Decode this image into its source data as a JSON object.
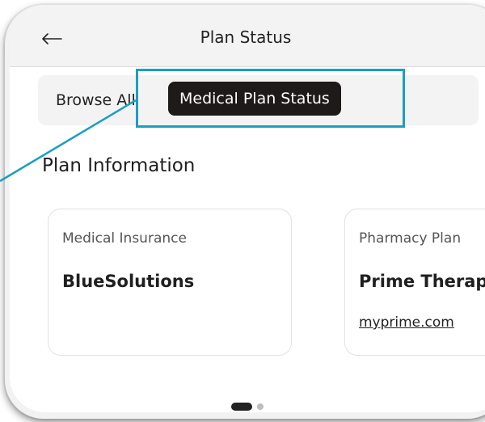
{
  "header": {
    "back_icon": "arrow-left-icon",
    "title": "Plan Status"
  },
  "browse": {
    "label": "Browse All"
  },
  "tooltip": {
    "text": "Medical Plan Status"
  },
  "section": {
    "title": "Plan Information"
  },
  "cards": [
    {
      "label": "Medical Insurance",
      "name": "BlueSolutions",
      "link": ""
    },
    {
      "label": "Pharmacy Plan",
      "name": "Prime Therapeutics",
      "link": "myprime.com"
    }
  ],
  "pager": {
    "pages": 2,
    "current": 1
  },
  "colors": {
    "highlight": "#1a9fc1",
    "tooltip_bg": "#1e1a19"
  }
}
